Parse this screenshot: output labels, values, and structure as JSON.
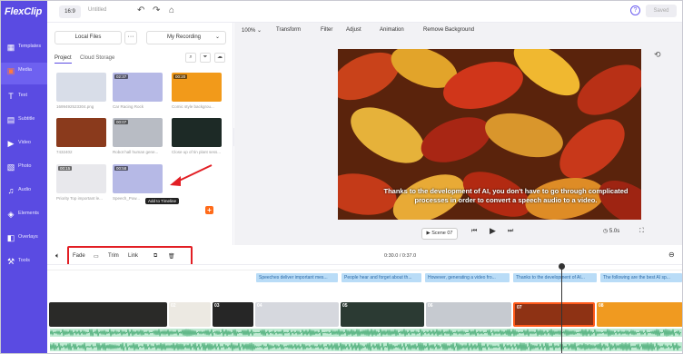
{
  "app": {
    "logo": "FlexClip"
  },
  "topbar": {
    "ratio": "16:9",
    "title": "Untitled",
    "saved_label": "Saved",
    "help": "?"
  },
  "sidebar": {
    "items": [
      {
        "label": "Templates",
        "icon": "template-icon",
        "glyph": "▦"
      },
      {
        "label": "Media",
        "icon": "media-icon",
        "glyph": "▣",
        "active": true
      },
      {
        "label": "Text",
        "icon": "text-icon",
        "glyph": "T"
      },
      {
        "label": "Subtitle",
        "icon": "subtitle-icon",
        "glyph": "▤"
      },
      {
        "label": "Video",
        "icon": "video-icon",
        "glyph": "▶"
      },
      {
        "label": "Photo",
        "icon": "photo-icon",
        "glyph": "▧"
      },
      {
        "label": "Audio",
        "icon": "audio-icon",
        "glyph": "♫"
      },
      {
        "label": "Elements",
        "icon": "elements-icon",
        "glyph": "◈"
      },
      {
        "label": "Overlays",
        "icon": "overlays-icon",
        "glyph": "◧"
      },
      {
        "label": "Tools",
        "icon": "tools-icon",
        "glyph": "⚒"
      }
    ]
  },
  "media_panel": {
    "local_files": "Local Files",
    "more": "···",
    "recording": "My Recording",
    "tabs": [
      "Project",
      "Cloud Storage"
    ],
    "items": [
      {
        "name": "1699492523304.png",
        "duration": "",
        "color": "#d8dde8"
      },
      {
        "name": "Car Racing Rock",
        "duration": "02:37",
        "color": "#b6b9e6"
      },
      {
        "name": "Comic style backgrou...",
        "duration": "00:20",
        "color": "#f29a1a"
      },
      {
        "name": "7432402",
        "duration": "",
        "color": "#8a3a1c"
      },
      {
        "name": "Robot hall human gene...",
        "duration": "00:07",
        "color": "#b8bcc4"
      },
      {
        "name": "Close up of tin plant sess...",
        "duration": "",
        "color": "#1d2a26"
      },
      {
        "name": "Priority Top important le...",
        "duration": "00:15",
        "color": "#e8e8ec"
      },
      {
        "name": "Speech_Pow...",
        "duration": "00:58",
        "color": "#b6b9e6"
      }
    ],
    "tooltip": "Add to Timeline"
  },
  "preview": {
    "zoom": "100%",
    "tools": [
      "Transform",
      "Filter",
      "Adjust",
      "Animation",
      "Remove Background"
    ],
    "caption": "Thanks to the development of AI, you don't have to go through complicated processes in order to convert a speech audio to a video.",
    "scene": "Scene 07",
    "speed": "5.0s"
  },
  "edit_tools": {
    "fade": "Fade",
    "trim": "Trim",
    "link": "Link",
    "timecode": "0:30.0 / 0:37.0"
  },
  "timeline": {
    "captions": [
      "Speeches deliver important mes...",
      "People hear and forget about th...",
      "However, generating a video fro...",
      "Thanks to the development of AI...",
      "The following are the best AI sp..."
    ],
    "clips": [
      {
        "num": "",
        "color": "#2a2a28"
      },
      {
        "num": "02",
        "color": "#ece9e2"
      },
      {
        "num": "03",
        "color": "#262626"
      },
      {
        "num": "04",
        "color": "#d6d8de"
      },
      {
        "num": "05",
        "color": "#2b3a33"
      },
      {
        "num": "06",
        "color": "#c6cad0"
      },
      {
        "num": "07",
        "color": "#8e3214"
      },
      {
        "num": "08",
        "color": "#f09a20"
      }
    ]
  }
}
